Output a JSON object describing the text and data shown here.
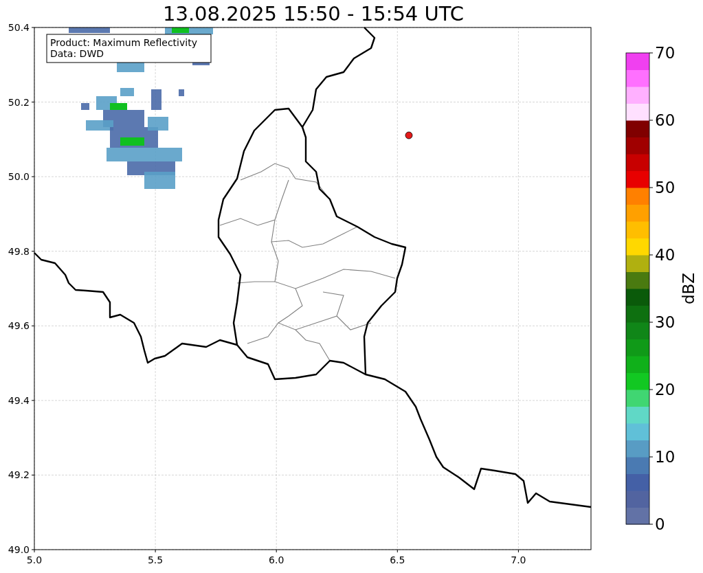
{
  "title": "13.08.2025 15:50 - 15:54 UTC",
  "legend": [
    "Product: Maximum Reflectivity",
    "Data: DWD"
  ],
  "map": {
    "xticks": [
      "5.0",
      "5.5",
      "6.0",
      "6.5",
      "7.0"
    ],
    "yticks": [
      "50.4",
      "50.2",
      "50.0",
      "49.8",
      "49.6",
      "49.4",
      "49.2",
      "49.0"
    ]
  },
  "colorbar": {
    "label": "dBZ",
    "ticks": [
      "70",
      "60",
      "50",
      "40",
      "30",
      "20",
      "10",
      "0"
    ],
    "bands": [
      {
        "color": "#6272a6"
      },
      {
        "color": "#5264a0"
      },
      {
        "color": "#4460a6"
      },
      {
        "color": "#4a7ab2"
      },
      {
        "color": "#589cc4"
      },
      {
        "color": "#60c0d8"
      },
      {
        "color": "#60d8c6"
      },
      {
        "color": "#40d672"
      },
      {
        "color": "#12c822"
      },
      {
        "color": "#10b01a"
      },
      {
        "color": "#109a18"
      },
      {
        "color": "#108618"
      },
      {
        "color": "#0e7010"
      },
      {
        "color": "#0a5a0a"
      },
      {
        "color": "#4a7a10"
      },
      {
        "color": "#b0b010"
      },
      {
        "color": "#ffd800"
      },
      {
        "color": "#ffbe00"
      },
      {
        "color": "#ffa000"
      },
      {
        "color": "#ff8000"
      },
      {
        "color": "#e80000"
      },
      {
        "color": "#c80000"
      },
      {
        "color": "#a00000"
      },
      {
        "color": "#800000"
      },
      {
        "color": "#ffe0ff"
      },
      {
        "color": "#ffb0ff"
      },
      {
        "color": "#ff70ff"
      },
      {
        "color": "#f040f0"
      }
    ]
  }
}
